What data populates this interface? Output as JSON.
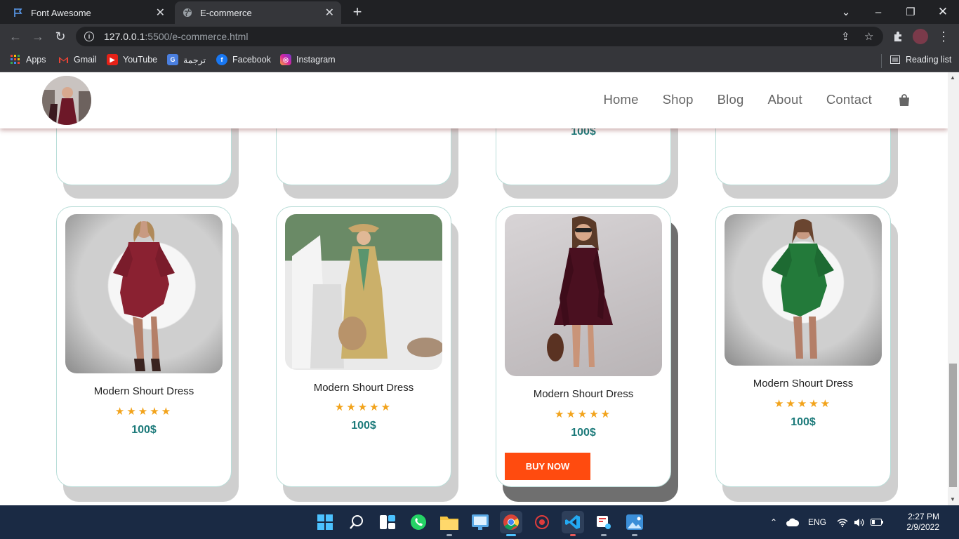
{
  "browser": {
    "tabs": [
      {
        "title": "Font Awesome",
        "icon": "flag-icon",
        "active": false
      },
      {
        "title": "E-commerce",
        "icon": "globe-icon",
        "active": true
      }
    ],
    "address": {
      "host": "127.0.0.1",
      "rest": ":5500/e-commerce.html"
    },
    "bookmarks": [
      {
        "label": "Apps",
        "icon": "apps-grid-icon"
      },
      {
        "label": "Gmail",
        "icon": "gmail-icon"
      },
      {
        "label": "YouTube",
        "icon": "youtube-icon"
      },
      {
        "label": "ترجمة",
        "icon": "translate-icon"
      },
      {
        "label": "Facebook",
        "icon": "facebook-icon"
      },
      {
        "label": "Instagram",
        "icon": "instagram-icon"
      }
    ],
    "reading_list": "Reading list"
  },
  "site": {
    "nav": [
      "Home",
      "Shop",
      "Blog",
      "About",
      "Contact"
    ],
    "cart_icon": "shopping-bag-icon"
  },
  "top_row": {
    "visible_price": "100$"
  },
  "products": [
    {
      "name": "Modern Shourt Dress",
      "stars": "★★★★★",
      "price": "100$",
      "dress_color": "#8a2131",
      "bg": "#e4e4e4"
    },
    {
      "name": "Modern Shourt Dress",
      "stars": "★★★★★",
      "price": "100$",
      "dress_color": "#cbb06a",
      "bg": "#dfe6de"
    },
    {
      "name": "Modern Shourt Dress",
      "stars": "★★★★★",
      "price": "100$",
      "dress_color": "#4a1020",
      "bg": "#c9c6c8",
      "button": "BUY NOW"
    },
    {
      "name": "Modern Shourt Dress",
      "stars": "★★★★★",
      "price": "100$",
      "dress_color": "#237a3a",
      "bg": "#e6e6e6"
    }
  ],
  "taskbar": {
    "tray_lang": "ENG",
    "time": "2:27 PM",
    "date": "2/9/2022"
  },
  "colors": {
    "accent_teal": "#1c7a7a",
    "star": "#f2a31b",
    "buy_button": "#ff4b0f"
  }
}
